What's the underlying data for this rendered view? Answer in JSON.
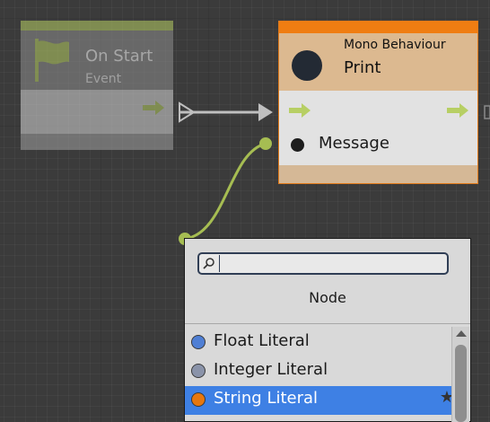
{
  "on_start_node": {
    "title": "On Start",
    "subtitle": "Event",
    "icon": "flag-icon"
  },
  "print_node": {
    "category": "Mono Behaviour",
    "title": "Print",
    "port_label": "Message"
  },
  "search_popup": {
    "search_value": "",
    "header": "Node",
    "items": [
      {
        "label": "Float Literal",
        "color": "#4f7fd4",
        "selected": false
      },
      {
        "label": "Integer Literal",
        "color": "#8a93a9",
        "selected": false
      },
      {
        "label": "String Literal",
        "color": "#e6770f",
        "selected": true,
        "icon": "star-icon"
      }
    ]
  },
  "colors": {
    "event_header": "#b7cf64",
    "print_header": "#ef7d12",
    "selection": "#3e80e4",
    "wire": "#a6bd52"
  }
}
